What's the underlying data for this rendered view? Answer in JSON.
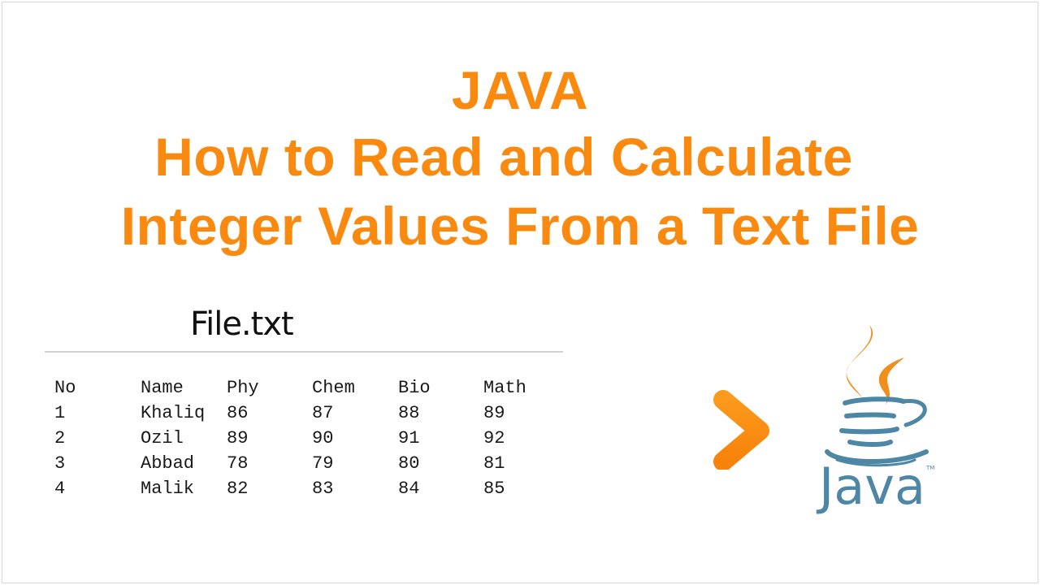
{
  "title": {
    "line1": "JAVA",
    "line2": "How to Read and Calculate",
    "line3": "Integer Values From a Text File"
  },
  "file": {
    "label": "File.txt",
    "columns": [
      "No",
      "Name",
      "Phy",
      "Chem",
      "Bio",
      "Math"
    ],
    "rows": [
      [
        "1",
        "Khaliq",
        "86",
        "87",
        "88",
        "89"
      ],
      [
        "2",
        "Ozil",
        "89",
        "90",
        "91",
        "92"
      ],
      [
        "3",
        "Abbad",
        "78",
        "79",
        "80",
        "81"
      ],
      [
        "4",
        "Malik",
        "82",
        "83",
        "84",
        "85"
      ]
    ]
  },
  "arrow": {
    "icon": "right-arrow-icon",
    "color": "#fa8a0f"
  },
  "logo": {
    "icon": "java-coffee-cup-icon",
    "wordmark": "Java",
    "trademark": "TM",
    "steam_color": "#f0901c",
    "cup_color": "#4e87a6"
  },
  "colors": {
    "title": "#fa8a0f",
    "text": "#1a1a1a",
    "divider": "#d2d2d2"
  }
}
